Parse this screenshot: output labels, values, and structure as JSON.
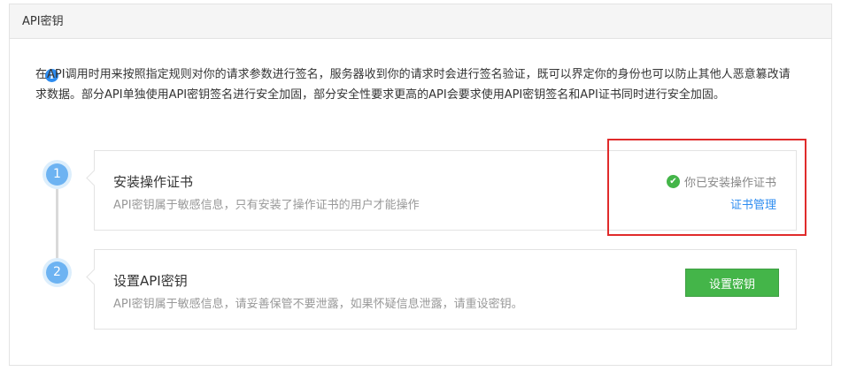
{
  "panel": {
    "title": "API密钥"
  },
  "notice": {
    "icon": "info-icon",
    "text": "在API调用时用来按照指定规则对你的请求参数进行签名，服务器收到你的请求时会进行签名验证，既可以界定你的身份也可以防止其他人恶意篡改请求数据。部分API单独使用API密钥签名进行安全加固，部分安全性要求更高的API会要求使用API密钥签名和API证书同时进行安全加固。"
  },
  "steps": [
    {
      "number": "1",
      "title": "安装操作证书",
      "description": "API密钥属于敏感信息，只有安装了操作证书的用户才能操作",
      "status_text": "你已安装操作证书",
      "status_icon": "check-circle-icon",
      "link_label": "证书管理"
    },
    {
      "number": "2",
      "title": "设置API密钥",
      "description": "API密钥属于敏感信息，请妥善保管不要泄露，如果怀疑信息泄露，请重设密钥。",
      "button_label": "设置密钥"
    }
  ],
  "colors": {
    "accent_green": "#44b549",
    "link_blue": "#2d8cf0",
    "step_blue": "#6db3f2",
    "highlight_red": "#e02b2b"
  }
}
